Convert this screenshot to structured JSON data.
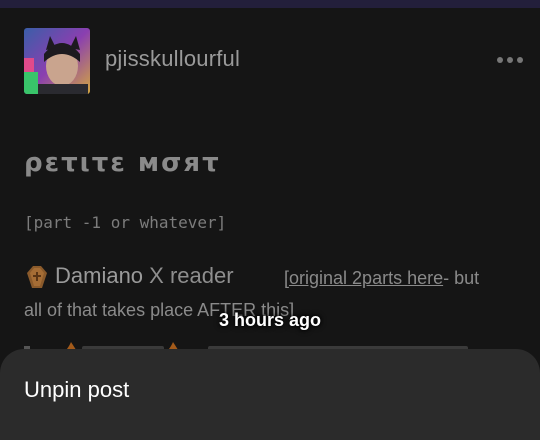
{
  "post": {
    "username": "pjisskullourful",
    "title": "ρετιτε мσяτ",
    "part_line": "[part -1 or whatever]",
    "heading_name": "Damiano",
    "heading_rest": " X reader",
    "bracket_open": "[",
    "link_text": "original 2parts here",
    "bracket_tail": "- but",
    "line_continued": "all of that takes place AFTER this]"
  },
  "toast": {
    "text": "3 hours ago"
  },
  "sheet": {
    "unpin_label": "Unpin post"
  },
  "colors": {
    "background": "#151515",
    "sheet": "#2b2b2b",
    "accent_strip": "#231f3b"
  }
}
